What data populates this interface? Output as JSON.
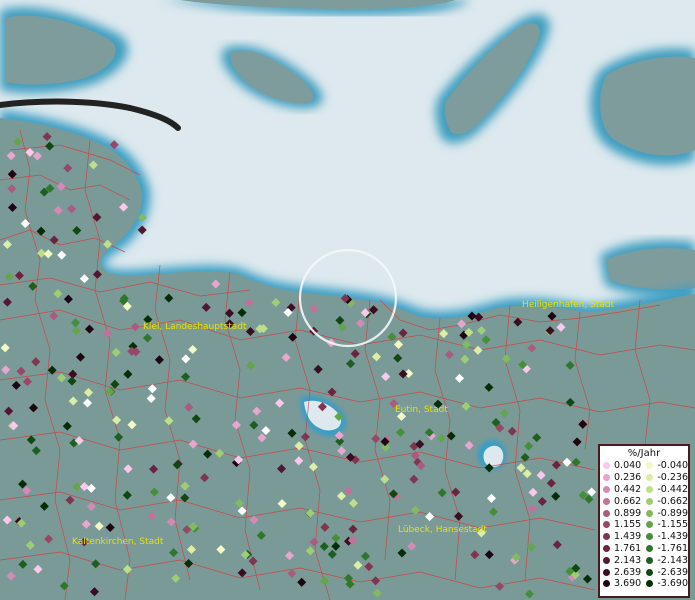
{
  "map": {
    "cities": [
      {
        "name": "Kiel, Landeshauptstadt"
      },
      {
        "name": "Heiligenhafen, Stadt"
      },
      {
        "name": "Eutin, Stadt"
      },
      {
        "name": "Kaltenkirchen, Stadt"
      },
      {
        "name": "Lübeck, Hansestadt"
      }
    ],
    "legend": {
      "title": "%/Jahr",
      "positive": [
        {
          "label": "0.040",
          "color": "#f9c8ea"
        },
        {
          "label": "0.236",
          "color": "#e8a6cf"
        },
        {
          "label": "0.442",
          "color": "#d48ab4"
        },
        {
          "label": "0.662",
          "color": "#c07298"
        },
        {
          "label": "0.899",
          "color": "#aa5c7f"
        },
        {
          "label": "1.155",
          "color": "#974867"
        },
        {
          "label": "1.439",
          "color": "#803550"
        },
        {
          "label": "1.761",
          "color": "#6a2440"
        },
        {
          "label": "2.143",
          "color": "#541730"
        },
        {
          "label": "2.639",
          "color": "#3a0d20"
        },
        {
          "label": "3.690",
          "color": "#1e0510"
        }
      ],
      "negative": [
        {
          "label": "-0.040",
          "color": "#f3f9c2"
        },
        {
          "label": "-0.236",
          "color": "#dceea6"
        },
        {
          "label": "-0.442",
          "color": "#bddf8a"
        },
        {
          "label": "-0.662",
          "color": "#9fcd74"
        },
        {
          "label": "-0.899",
          "color": "#82ba60"
        },
        {
          "label": "-1.155",
          "color": "#63a54c"
        },
        {
          "label": "-1.439",
          "color": "#468f3a"
        },
        {
          "label": "-1.761",
          "color": "#2f772b"
        },
        {
          "label": "-2.143",
          "color": "#1d5f1e"
        },
        {
          "label": "-2.639",
          "color": "#104713"
        },
        {
          "label": "-3.690",
          "color": "#052e08"
        }
      ]
    }
  }
}
